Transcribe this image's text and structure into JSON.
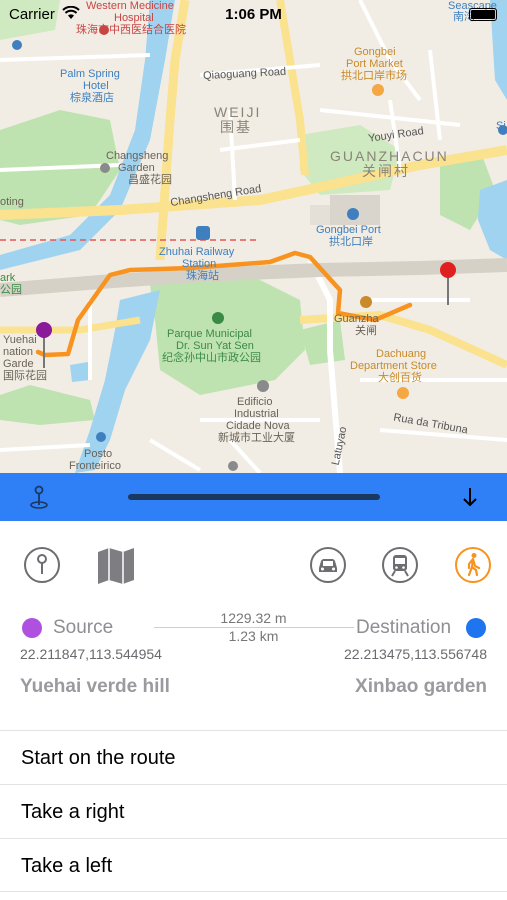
{
  "status_bar": {
    "carrier": "Carrier",
    "time": "1:06 PM"
  },
  "map": {
    "labels": {
      "western_medicine": "Western Medicine",
      "hospital": "Hospital",
      "hospital_cn": "珠海市中西医结合医院",
      "palm_spring": "Palm Spring",
      "hotel": "Hotel",
      "palm_spring_cn": "棕泉酒店",
      "qiaoguang_road": "Qiaoguang Road",
      "gongbei_market": "Gongbei",
      "port_market": "Port Market",
      "gongbei_market_cn": "拱北口岸市场",
      "weiji": "WEIJI",
      "weiji_cn": "围基",
      "youyi_road": "Youyi Road",
      "seascape": "Seascape",
      "seascape_cn": "南湾",
      "si": "Si",
      "changsheng_garden": "Changsheng",
      "garden": "Garden",
      "changsheng_cn": "昌盛花园",
      "guanzhacun": "GUANZHACUN",
      "guanzhacun_cn": "关闸村",
      "oting": "oting",
      "changsheng_road": "Changsheng Road",
      "gongbei_port": "Gongbei Port",
      "gongbei_port_cn": "拱北口岸",
      "zhuhai_railway": "Zhuhai Railway",
      "station": "Station",
      "zhuhai_station_cn": "珠海站",
      "ark": "ark",
      "gong": "公园",
      "yuehai": "Yuehai",
      "yuehai_nation": "nation",
      "yuehai_garden": "Garde",
      "yuehai_cn": "国际花园",
      "parque_municipal": "Parque Municipal",
      "dr_sun": "Dr. Sun Yat Sen",
      "parque_cn": "纪念孙中山市政公园",
      "guanzha": "Guanzha",
      "guanzha_cn": "关闸",
      "dachuang": "Dachuang",
      "department_store": "Department Store",
      "dachuang_cn": "大创百货",
      "edificio": "Edificio",
      "industrial": "Industrial",
      "cidade_nova": "Cidade Nova",
      "edificio_cn": "新城市工业大厦",
      "rua_tribuna": "Rua da Tribuna",
      "latuyao": "Latuyao",
      "posto": "Posto",
      "fronteirico": "Fronteirico"
    }
  },
  "route": {
    "source_label": "Source",
    "destination_label": "Destination",
    "distance_m": "1229.32 m",
    "distance_km": "1.23 km",
    "source_coord": "22.211847,113.544954",
    "destination_coord": "22.213475,113.556748",
    "source_name": "Yuehai verde hill",
    "destination_name": "Xinbao garden"
  },
  "modes": [
    "pin-icon",
    "map-icon",
    "car-icon",
    "train-icon",
    "walk-icon"
  ],
  "colors": {
    "accent_blue": "#2f7ff7",
    "route_orange": "#f7931e",
    "source_purple": "#b050e0",
    "destination_blue": "#1f75f0",
    "active_mode": "#f7931e"
  },
  "steps": [
    "Start on the route",
    "Take a right",
    "Take a left"
  ]
}
